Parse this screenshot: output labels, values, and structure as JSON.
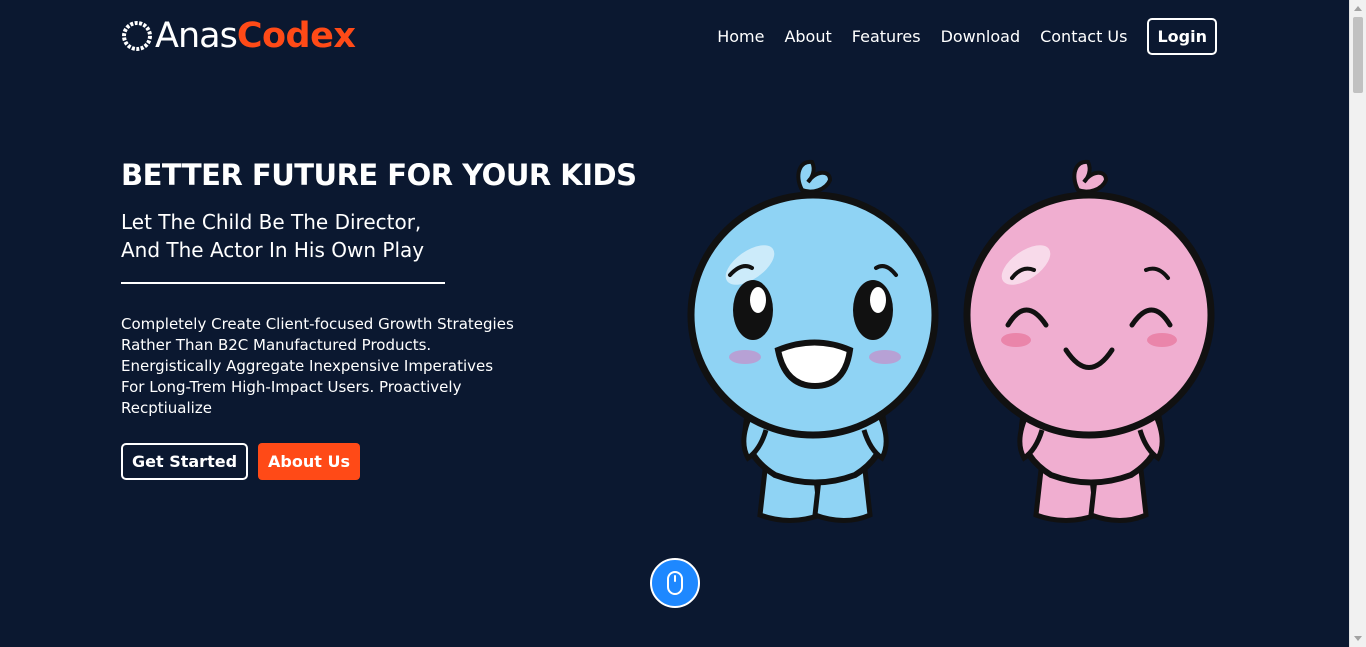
{
  "brand": {
    "name_part1": "Anas",
    "name_part2": "Codex",
    "accent_color": "#ff4a17"
  },
  "nav": {
    "items": [
      "Home",
      "About",
      "Features",
      "Download",
      "Contact Us"
    ],
    "login_label": "Login"
  },
  "hero": {
    "title": "BETTER FUTURE FOR YOUR KIDS",
    "subtitle_line1": "Let The Child Be The Director,",
    "subtitle_line2": "And The Actor In His Own Play",
    "description": "Completely Create Client-focused Growth Strategies Rather Than B2C Manufactured Products. Energistically Aggregate Inexpensive Imperatives For Long-Trem High-Impact Users. Proactively Recptiualize",
    "primary_button": "Get Started",
    "secondary_button": "About Us"
  },
  "icons": {
    "logo": "circle-logo-icon",
    "scroll": "mouse-icon",
    "illustration": "kids-characters-illustration"
  },
  "colors": {
    "background": "#0b1830",
    "scroll_button": "#1e88ff",
    "blue_character": "#8fd3f4",
    "pink_character": "#f0aed0"
  }
}
